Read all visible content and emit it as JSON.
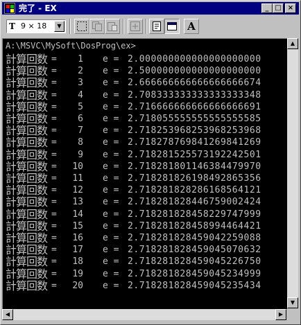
{
  "window": {
    "title": "完了 - EX"
  },
  "title_buttons": {
    "minimize": "_",
    "maximize": "□",
    "close": "×"
  },
  "toolbar": {
    "font_icon": "T",
    "font_size": "9 × 18",
    "font_dropdown_arrow": "▼",
    "buttons": [
      "mark-icon",
      "copy-icon",
      "paste-icon",
      "fullscreen-icon",
      "properties-icon",
      "background-icon",
      "font-icon"
    ],
    "font_button_label": "A"
  },
  "console": {
    "prompt": "A:\\MSVC\\MySoft\\DosProg\\ex>",
    "label": "計算回数",
    "eq": "=",
    "e_label": "e =",
    "rows": [
      {
        "n": "1",
        "e": "2.000000000000000000000"
      },
      {
        "n": "2",
        "e": "2.500000000000000000000"
      },
      {
        "n": "3",
        "e": "2.666666666666666666674"
      },
      {
        "n": "4",
        "e": "2.708333333333333333348"
      },
      {
        "n": "5",
        "e": "2.716666666666666666691"
      },
      {
        "n": "6",
        "e": "2.718055555555555555585"
      },
      {
        "n": "7",
        "e": "2.718253968253968253968"
      },
      {
        "n": "8",
        "e": "2.718278769841269841269"
      },
      {
        "n": "9",
        "e": "2.718281525573192242501"
      },
      {
        "n": "10",
        "e": "2.718281801146384479970"
      },
      {
        "n": "11",
        "e": "2.718281826198492865356"
      },
      {
        "n": "12",
        "e": "2.718281828286168564121"
      },
      {
        "n": "13",
        "e": "2.718281828446759002424"
      },
      {
        "n": "14",
        "e": "2.718281828458229747999"
      },
      {
        "n": "15",
        "e": "2.718281828458994464421"
      },
      {
        "n": "16",
        "e": "2.718281828459042259088"
      },
      {
        "n": "17",
        "e": "2.718281828459045070632"
      },
      {
        "n": "18",
        "e": "2.718281828459045226750"
      },
      {
        "n": "19",
        "e": "2.718281828459045234999"
      },
      {
        "n": "20",
        "e": "2.718281828459045235434"
      }
    ]
  },
  "scrollbar": {
    "up": "▲",
    "down": "▼",
    "left": "◀",
    "right": "▶"
  },
  "colors": {
    "titlebar": "#000080",
    "console_bg": "#000000",
    "console_text": "#c0c0c0",
    "chrome": "#c0c0c0"
  }
}
